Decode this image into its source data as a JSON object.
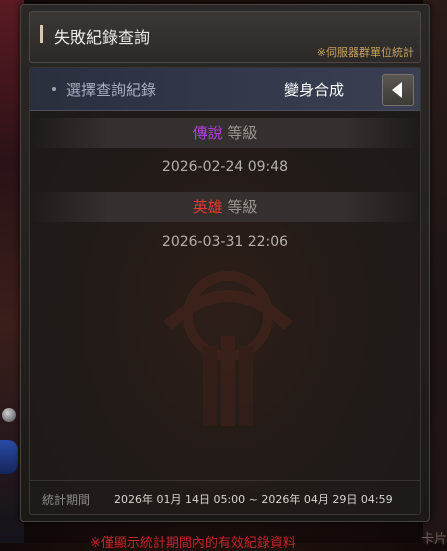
{
  "header": {
    "title": "失敗紀錄查詢",
    "note": "※伺服器群單位統計"
  },
  "selector": {
    "label": "選擇查詢紀錄",
    "value": "變身合成"
  },
  "records": [
    {
      "grade": "傳說",
      "grade_color": "#b040e0",
      "suffix": "等級",
      "date": "2026-02-24 09:48"
    },
    {
      "grade": "英雄",
      "grade_color": "#e03a2e",
      "suffix": "等級",
      "date": "2026-03-31 22:06"
    }
  ],
  "footer": {
    "label": "統計期間",
    "period": "2026年 01月 14日 05:00 ~ 2026年 04月 29日 04:59"
  },
  "background": {
    "bottom_text": "※僅顯示統計期間內的有效紀錄資料",
    "right_text": "卡片"
  },
  "colors": {
    "accent_gold": "#c8a45a",
    "selector_bg": "#343a4c"
  }
}
